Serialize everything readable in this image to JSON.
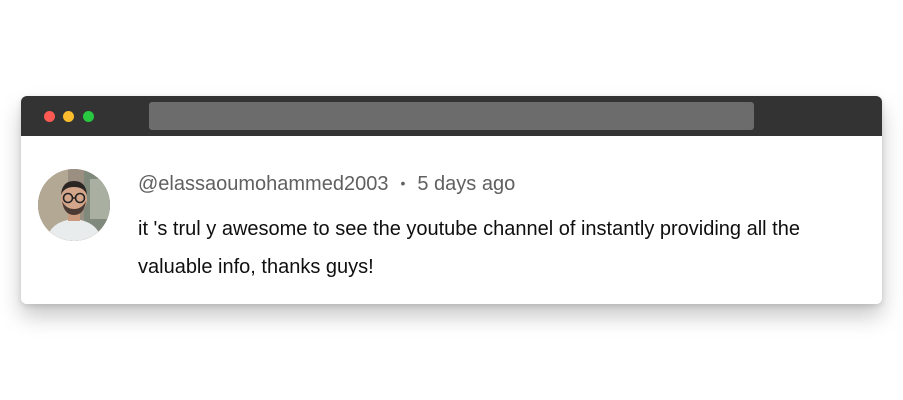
{
  "window": {
    "titlebar_color": "#333333",
    "buttons": {
      "close_color": "#fd5a53",
      "minimize_color": "#fbbd2d",
      "maximize_color": "#28c940"
    },
    "address_bar_color": "#6c6c6c"
  },
  "comment": {
    "avatar_icon": "user-avatar",
    "username": "@elassaoumohammed2003",
    "separator": "•",
    "timestamp": "5 days ago",
    "text": "it 's trul y awesome to see the youtube channel of instantly providing all the valuable info, thanks guys!"
  }
}
